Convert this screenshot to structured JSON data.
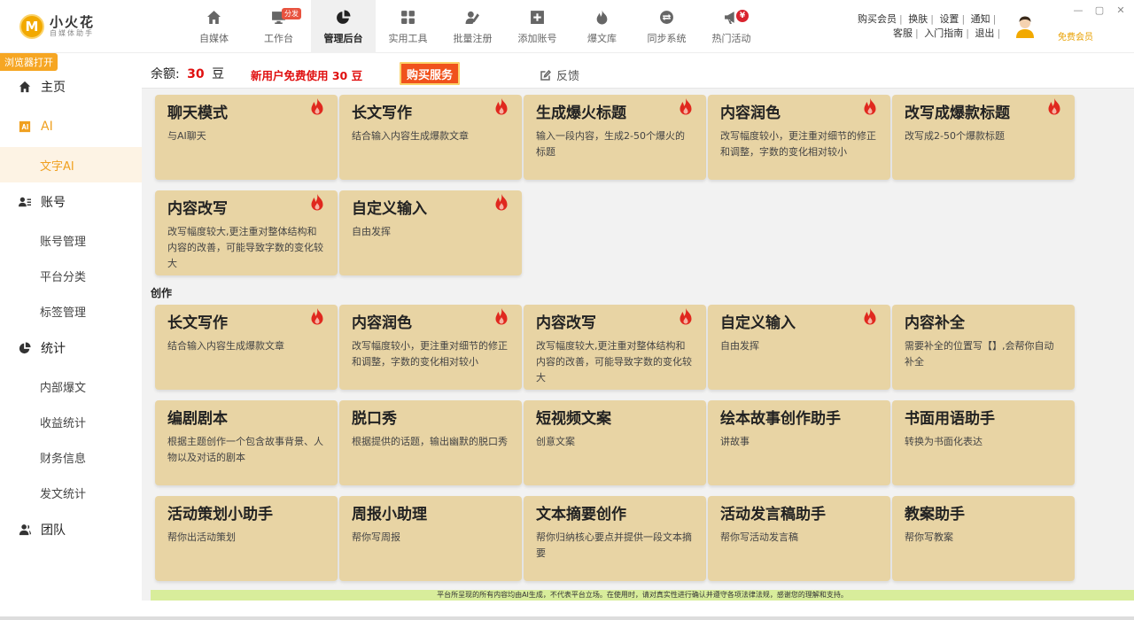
{
  "app": {
    "logo_letter": "M",
    "name": "小火花",
    "subtitle": "自媒体助手",
    "accent_color": "#f0a020",
    "card_color": "#e8d4a4"
  },
  "nav": [
    {
      "label": "自媒体",
      "icon": "home-icon"
    },
    {
      "label": "工作台",
      "icon": "monitor-icon",
      "badge": "分发"
    },
    {
      "label": "管理后台",
      "icon": "pie-chart-icon",
      "active": true
    },
    {
      "label": "实用工具",
      "icon": "grid-icon"
    },
    {
      "label": "批量注册",
      "icon": "user-edit-icon"
    },
    {
      "label": "添加账号",
      "icon": "plus-square-icon"
    },
    {
      "label": "爆文库",
      "icon": "flame-icon"
    },
    {
      "label": "同步系统",
      "icon": "sync-icon"
    },
    {
      "label": "热门活动",
      "icon": "megaphone-icon",
      "badge_symbol": "¥"
    }
  ],
  "top_links": {
    "row1": [
      "购买会员",
      "换肤",
      "设置",
      "通知"
    ],
    "row2": [
      "客服",
      "入门指南",
      "退出"
    ],
    "vip": "免费会员"
  },
  "sidebar": {
    "open_browser": "浏览器打开",
    "items": [
      {
        "label": "主页",
        "icon": "home-icon"
      },
      {
        "label": "AI",
        "icon": "ai-icon"
      },
      {
        "label": "文字AI",
        "sub": true
      },
      {
        "label": "账号",
        "icon": "user-card-icon"
      },
      {
        "label": "账号管理",
        "sub": true
      },
      {
        "label": "平台分类",
        "sub": true
      },
      {
        "label": "标签管理",
        "sub": true
      },
      {
        "label": "统计",
        "icon": "pie-chart-icon"
      },
      {
        "label": "内部爆文",
        "sub": true
      },
      {
        "label": "收益统计",
        "sub": true
      },
      {
        "label": "财务信息",
        "sub": true
      },
      {
        "label": "发文统计",
        "sub": true
      },
      {
        "label": "团队",
        "icon": "team-icon"
      }
    ]
  },
  "infobar": {
    "balance_label": "余额:",
    "balance_value": "30",
    "balance_unit": "豆",
    "promo": "新用户免费使用 30 豆",
    "buy_button": "购买服务",
    "feedback": "反馈"
  },
  "section_label": "创作",
  "cards_top": [
    {
      "title": "聊天模式",
      "desc": "与AI聊天",
      "hot": true
    },
    {
      "title": "长文写作",
      "desc": "结合输入内容生成爆款文章",
      "hot": true
    },
    {
      "title": "生成爆火标题",
      "desc": "输入一段内容，生成2-50个爆火的标题",
      "hot": true
    },
    {
      "title": "内容润色",
      "desc": "改写幅度较小，更注重对细节的修正和调整，字数的变化相对较小",
      "hot": true
    },
    {
      "title": "改写成爆款标题",
      "desc": "改写成2-50个爆款标题",
      "hot": true
    },
    {
      "title": "内容改写",
      "desc": "改写幅度较大,更注重对整体结构和内容的改善，可能导致字数的变化较大",
      "hot": true
    },
    {
      "title": "自定义输入",
      "desc": "自由发挥",
      "hot": true
    }
  ],
  "cards_create": [
    {
      "title": "长文写作",
      "desc": "结合输入内容生成爆款文章",
      "hot": true
    },
    {
      "title": "内容润色",
      "desc": "改写幅度较小，更注重对细节的修正和调整，字数的变化相对较小",
      "hot": true
    },
    {
      "title": "内容改写",
      "desc": "改写幅度较大,更注重对整体结构和内容的改善，可能导致字数的变化较大",
      "hot": true
    },
    {
      "title": "自定义输入",
      "desc": "自由发挥",
      "hot": true
    },
    {
      "title": "内容补全",
      "desc": "需要补全的位置写【】,会帮你自动补全",
      "hot": false
    },
    {
      "title": "编剧剧本",
      "desc": "根据主题创作一个包含故事背景、人物以及对话的剧本",
      "hot": false
    },
    {
      "title": "脱口秀",
      "desc": "根据提供的话题，输出幽默的脱口秀",
      "hot": false
    },
    {
      "title": "短视频文案",
      "desc": "创意文案",
      "hot": false
    },
    {
      "title": "绘本故事创作助手",
      "desc": "讲故事",
      "hot": false
    },
    {
      "title": "书面用语助手",
      "desc": "转换为书面化表达",
      "hot": false
    },
    {
      "title": "活动策划小助手",
      "desc": "帮你出活动策划",
      "hot": false
    },
    {
      "title": "周报小助理",
      "desc": "帮你写周报",
      "hot": false
    },
    {
      "title": "文本摘要创作",
      "desc": "帮你归纳核心要点并提供一段文本摘要",
      "hot": false
    },
    {
      "title": "活动发言稿助手",
      "desc": "帮你写活动发言稿",
      "hot": false
    },
    {
      "title": "教案助手",
      "desc": "帮你写教案",
      "hot": false
    }
  ],
  "footer_note": "平台所呈现的所有内容均由AI生成，不代表平台立场。在使用时，请对真实性进行确认并遵守各项法律法规，感谢您的理解和支持。"
}
